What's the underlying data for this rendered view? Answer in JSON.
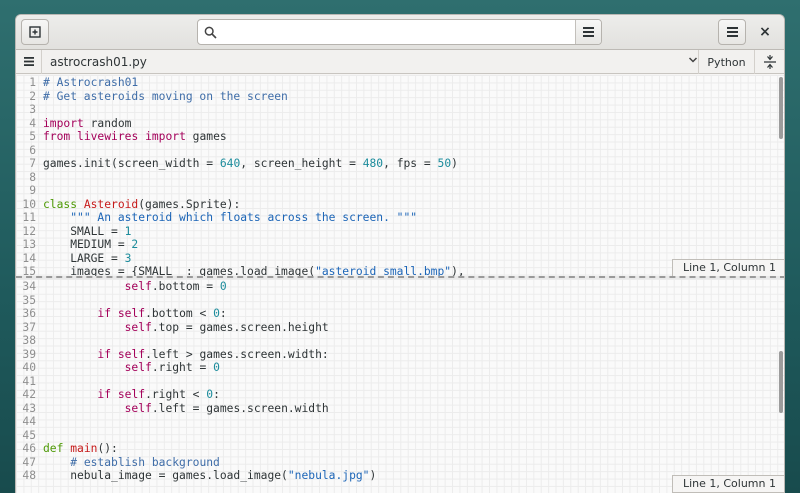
{
  "header": {
    "search_placeholder": "",
    "close_glyph": "×"
  },
  "tab": {
    "file_name": "astrocrash01.py",
    "language": "Python"
  },
  "status": {
    "top": "Line 1, Column 1",
    "bottom": "Line 1, Column 1"
  },
  "icons": [
    "new-document-icon",
    "search-icon",
    "hamburger-menu-icon",
    "close-icon",
    "chevron-down-icon",
    "split-view-icon"
  ],
  "colors": {
    "comment": "#3f6da8",
    "keyword": "#a4005a",
    "function": "#4e9a06",
    "class": "#c61a1a",
    "string": "#1c65b7",
    "number": "#1c8c9c"
  },
  "editor_top": [
    {
      "n": "1",
      "tokens": [
        [
          "cmt",
          "# Astrocrash01"
        ]
      ]
    },
    {
      "n": "2",
      "tokens": [
        [
          "cmt",
          "# Get asteroids moving on the screen"
        ]
      ]
    },
    {
      "n": "3",
      "tokens": []
    },
    {
      "n": "4",
      "tokens": [
        [
          "kw",
          "import"
        ],
        [
          "",
          " random"
        ]
      ]
    },
    {
      "n": "5",
      "tokens": [
        [
          "kw",
          "from"
        ],
        [
          "",
          " "
        ],
        [
          "kw",
          "livewires"
        ],
        [
          "",
          " "
        ],
        [
          "kw",
          "import"
        ],
        [
          "",
          " games"
        ]
      ]
    },
    {
      "n": "6",
      "tokens": []
    },
    {
      "n": "7",
      "tokens": [
        [
          "",
          "games.init(screen_width = "
        ],
        [
          "num",
          "640"
        ],
        [
          "",
          ", screen_height = "
        ],
        [
          "num",
          "480"
        ],
        [
          "",
          ", fps = "
        ],
        [
          "num",
          "50"
        ],
        [
          "",
          ")"
        ]
      ]
    },
    {
      "n": "8",
      "tokens": []
    },
    {
      "n": "9",
      "tokens": []
    },
    {
      "n": "10",
      "tokens": [
        [
          "fn",
          "class"
        ],
        [
          "",
          " "
        ],
        [
          "cls",
          "Asteroid"
        ],
        [
          "",
          "(games.Sprite):"
        ]
      ]
    },
    {
      "n": "11",
      "tokens": [
        [
          "",
          "    "
        ],
        [
          "str",
          "\"\"\" An asteroid which floats across the screen. \"\"\""
        ]
      ]
    },
    {
      "n": "12",
      "tokens": [
        [
          "",
          "    SMALL = "
        ],
        [
          "num",
          "1"
        ]
      ]
    },
    {
      "n": "13",
      "tokens": [
        [
          "",
          "    MEDIUM = "
        ],
        [
          "num",
          "2"
        ]
      ]
    },
    {
      "n": "14",
      "tokens": [
        [
          "",
          "    LARGE = "
        ],
        [
          "num",
          "3"
        ]
      ]
    },
    {
      "n": "15",
      "tokens": [
        [
          "",
          "    images = {SMALL  : games.load_image("
        ],
        [
          "str",
          "\"asteroid_small.bmp\""
        ],
        [
          "",
          "),"
        ]
      ]
    }
  ],
  "editor_bottom": [
    {
      "n": "34",
      "tokens": [
        [
          "",
          "            "
        ],
        [
          "kw",
          "self"
        ],
        [
          "",
          ".bottom = "
        ],
        [
          "num",
          "0"
        ]
      ]
    },
    {
      "n": "35",
      "tokens": []
    },
    {
      "n": "36",
      "tokens": [
        [
          "",
          "        "
        ],
        [
          "kw",
          "if"
        ],
        [
          "",
          " "
        ],
        [
          "kw",
          "self"
        ],
        [
          "",
          ".bottom < "
        ],
        [
          "num",
          "0"
        ],
        [
          "",
          ":"
        ]
      ]
    },
    {
      "n": "37",
      "tokens": [
        [
          "",
          "            "
        ],
        [
          "kw",
          "self"
        ],
        [
          "",
          ".top = games.screen.height"
        ]
      ]
    },
    {
      "n": "38",
      "tokens": []
    },
    {
      "n": "39",
      "tokens": [
        [
          "",
          "        "
        ],
        [
          "kw",
          "if"
        ],
        [
          "",
          " "
        ],
        [
          "kw",
          "self"
        ],
        [
          "",
          ".left > games.screen.width:"
        ]
      ]
    },
    {
      "n": "40",
      "tokens": [
        [
          "",
          "            "
        ],
        [
          "kw",
          "self"
        ],
        [
          "",
          ".right = "
        ],
        [
          "num",
          "0"
        ]
      ]
    },
    {
      "n": "41",
      "tokens": []
    },
    {
      "n": "42",
      "tokens": [
        [
          "",
          "        "
        ],
        [
          "kw",
          "if"
        ],
        [
          "",
          " "
        ],
        [
          "kw",
          "self"
        ],
        [
          "",
          ".right < "
        ],
        [
          "num",
          "0"
        ],
        [
          "",
          ":"
        ]
      ]
    },
    {
      "n": "43",
      "tokens": [
        [
          "",
          "            "
        ],
        [
          "kw",
          "self"
        ],
        [
          "",
          ".left = games.screen.width"
        ]
      ]
    },
    {
      "n": "44",
      "tokens": []
    },
    {
      "n": "45",
      "tokens": []
    },
    {
      "n": "46",
      "tokens": [
        [
          "fn",
          "def"
        ],
        [
          "",
          " "
        ],
        [
          "cls",
          "main"
        ],
        [
          "",
          "():"
        ]
      ]
    },
    {
      "n": "47",
      "tokens": [
        [
          "",
          "    "
        ],
        [
          "cmt",
          "# establish background"
        ]
      ]
    },
    {
      "n": "48",
      "tokens": [
        [
          "",
          "    nebula_image = games.load_image("
        ],
        [
          "str",
          "\"nebula.jpg\""
        ],
        [
          "",
          ")"
        ]
      ]
    }
  ]
}
